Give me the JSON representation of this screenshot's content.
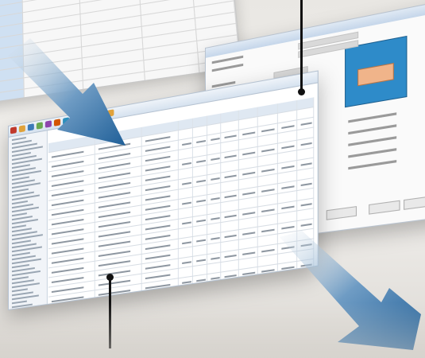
{
  "scene": {
    "background_color": "#ece9e5",
    "accent_color": "#2f74ad"
  },
  "windows": [
    {
      "name": "spreadsheet-window",
      "type": "spreadsheet"
    },
    {
      "name": "dialog-window",
      "type": "properties-dialog"
    },
    {
      "name": "main-app-window",
      "type": "table-editor"
    }
  ],
  "arrows": [
    {
      "name": "flow-arrow-left",
      "direction": "down-right"
    },
    {
      "name": "flow-arrow-right",
      "direction": "down-right"
    }
  ],
  "callouts": [
    {
      "name": "callout-dialog",
      "target": "dialog-window"
    },
    {
      "name": "callout-main",
      "target": "main-app-window"
    }
  ]
}
